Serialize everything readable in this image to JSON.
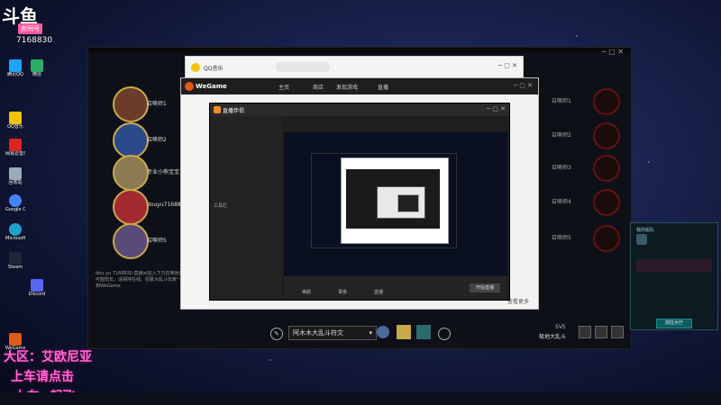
{
  "stream_overlay": {
    "room_label": "房间号",
    "room_number": "7168830",
    "region_line": "大区：艾欧尼亚",
    "join_line": "上车请点击",
    "link_line": "<上车~起飞>"
  },
  "desktop_icons": [
    {
      "label": "腾讯QQ",
      "icon": "qq-icon",
      "color": "#1aa3ff"
    },
    {
      "label": "微信",
      "icon": "wechat-icon",
      "color": "#2aae67"
    },
    {
      "label": "QQ音乐",
      "icon": "music-icon",
      "color": "#f7c300"
    },
    {
      "label": "网易云音乐",
      "icon": "netease-icon",
      "color": "#d8261e"
    },
    {
      "label": "回收站",
      "icon": "recycle-icon",
      "color": "#9ab"
    },
    {
      "label": "Google Chrome",
      "icon": "chrome-icon",
      "color": "#4285f4"
    },
    {
      "label": "Microsoft Edge",
      "icon": "edge-icon",
      "color": "#1fa3c9"
    },
    {
      "label": "Steam",
      "icon": "steam-icon",
      "color": "#1b2838"
    },
    {
      "label": "Discord",
      "icon": "discord-icon",
      "color": "#5865f2"
    },
    {
      "label": "WeGame",
      "icon": "wegame-icon",
      "color": "#e05a1a"
    }
  ],
  "qq_music": {
    "title": "QQ音乐"
  },
  "wegame": {
    "logo": "WeGame",
    "tabs": [
      "主页",
      "商店",
      "发现游戏",
      "直播"
    ],
    "bottom_link": "查看更多"
  },
  "obs": {
    "title": "直播伴侣",
    "toolbar": [
      "工具栏",
      "美颜",
      "录像",
      "直播"
    ],
    "status": "开始直播"
  },
  "game_client": {
    "summoner_slots": [
      "召唤师1",
      "召唤师2",
      "召唤师3",
      "召唤师4",
      "召唤师5"
    ],
    "left_slots": [
      "召唤师1",
      "召唤师2",
      "专业小熊宝宝",
      "douyu7168830",
      "召唤师5"
    ],
    "mode": "阿木木大乱斗符文",
    "team_size": "5V5",
    "map": "极地大乱斗",
    "info_text": "dou yu 7168830 直播间加入下方召唤师房间，等待时间可能较长，请保持在线。招募大乱斗玩家一起开黑，欢迎来到WeGame"
  },
  "party_popup": {
    "title": "我的组队",
    "join_button": "前往大厅"
  }
}
